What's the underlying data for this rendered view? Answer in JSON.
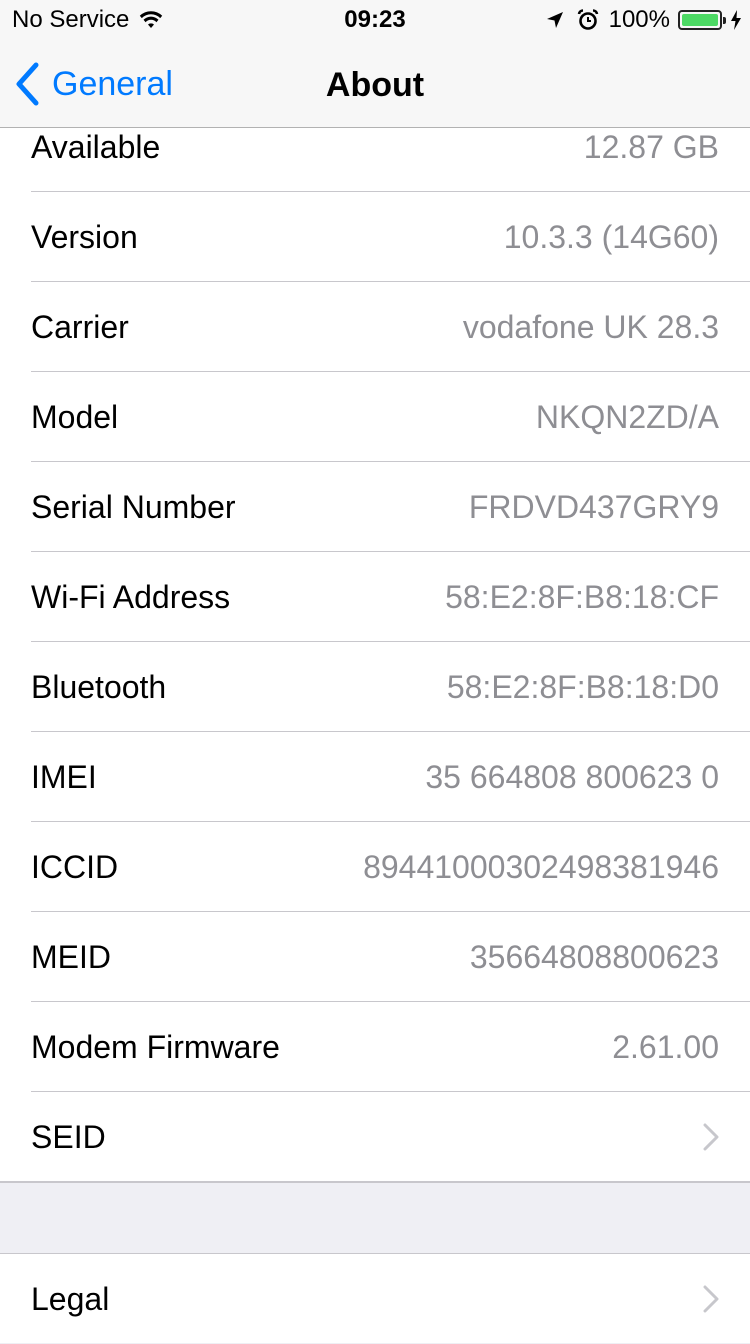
{
  "status_bar": {
    "carrier": "No Service",
    "time": "09:23",
    "battery_percent_text": "100%",
    "battery_level": 1.0,
    "battery_color": "#4cd964"
  },
  "nav": {
    "back_label": "General",
    "title": "About",
    "accent_color": "#007aff"
  },
  "rows": [
    {
      "label": "Available",
      "value": "12.87 GB"
    },
    {
      "label": "Version",
      "value": "10.3.3 (14G60)"
    },
    {
      "label": "Carrier",
      "value": "vodafone UK 28.3"
    },
    {
      "label": "Model",
      "value": "NKQN2ZD/A"
    },
    {
      "label": "Serial Number",
      "value": "FRDVD437GRY9"
    },
    {
      "label": "Wi-Fi Address",
      "value": "58:E2:8F:B8:18:CF"
    },
    {
      "label": "Bluetooth",
      "value": "58:E2:8F:B8:18:D0"
    },
    {
      "label": "IMEI",
      "value": "35 664808 800623 0"
    },
    {
      "label": "ICCID",
      "value": "89441000302498381946"
    },
    {
      "label": "MEID",
      "value": "35664808800623"
    },
    {
      "label": "Modem Firmware",
      "value": "2.61.00"
    },
    {
      "label": "SEID",
      "icon": "chevron-right-icon"
    }
  ],
  "legal": {
    "label": "Legal",
    "icon": "chevron-right-icon"
  }
}
